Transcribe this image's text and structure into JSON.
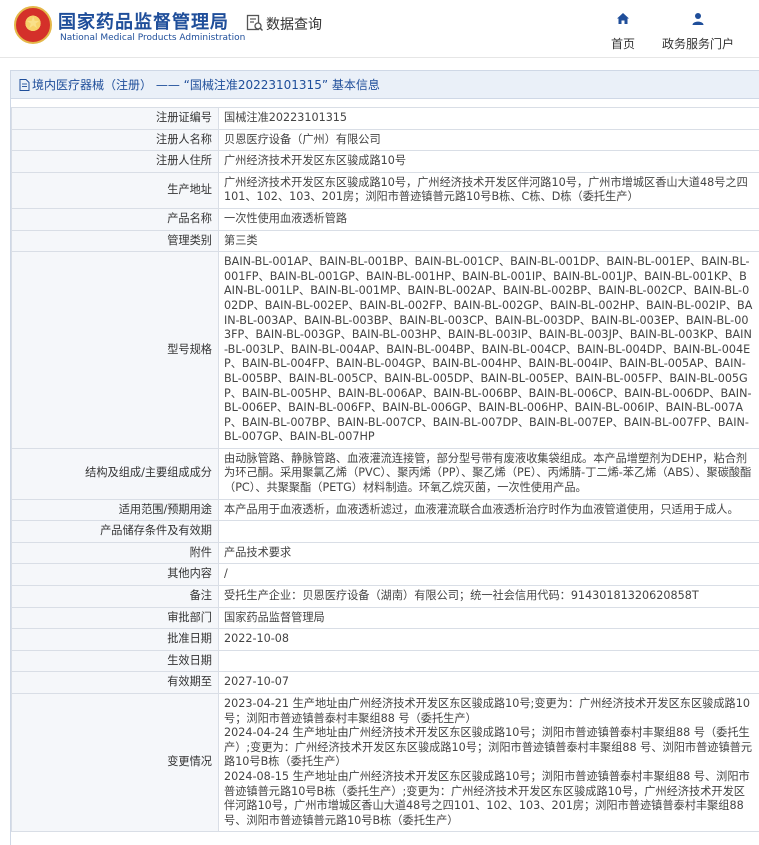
{
  "header": {
    "logo_cn": "国家药品监督管理局",
    "logo_en": "National Medical Products Administration",
    "search_title": "数据查询",
    "nav": [
      {
        "label": "首页",
        "icon": "home-icon"
      },
      {
        "label": "政务服务门户",
        "icon": "user-icon"
      }
    ]
  },
  "panel": {
    "breadcrumb": "境内医疗器械（注册） —— “国械注准20223101315” 基本信息"
  },
  "rows": [
    {
      "label": "注册证编号",
      "value": "国械注准20223101315"
    },
    {
      "label": "注册人名称",
      "value": "贝恩医疗设备（广州）有限公司"
    },
    {
      "label": "注册人住所",
      "value": "广州经济技术开发区东区骏成路10号"
    },
    {
      "label": "生产地址",
      "value": "广州经济技术开发区东区骏成路10号，广州经济技术开发区伴河路10号，广州市增城区香山大道48号之四101、102、103、201房；浏阳市普迹镇普元路10号B栋、C栋、D栋（委托生产）"
    },
    {
      "label": "产品名称",
      "value": "一次性使用血液透析管路"
    },
    {
      "label": "管理类别",
      "value": "第三类"
    },
    {
      "label": "型号规格",
      "value": "BAIN-BL-001AP、BAIN-BL-001BP、BAIN-BL-001CP、BAIN-BL-001DP、BAIN-BL-001EP、BAIN-BL-001FP、BAIN-BL-001GP、BAIN-BL-001HP、BAIN-BL-001IP、BAIN-BL-001JP、BAIN-BL-001KP、BAIN-BL-001LP、BAIN-BL-001MP、BAIN-BL-002AP、BAIN-BL-002BP、BAIN-BL-002CP、BAIN-BL-002DP、BAIN-BL-002EP、BAIN-BL-002FP、BAIN-BL-002GP、BAIN-BL-002HP、BAIN-BL-002IP、BAIN-BL-003AP、BAIN-BL-003BP、BAIN-BL-003CP、BAIN-BL-003DP、BAIN-BL-003EP、BAIN-BL-003FP、BAIN-BL-003GP、BAIN-BL-003HP、BAIN-BL-003IP、BAIN-BL-003JP、BAIN-BL-003KP、BAIN-BL-003LP、BAIN-BL-004AP、BAIN-BL-004BP、BAIN-BL-004CP、BAIN-BL-004DP、BAIN-BL-004EP、BAIN-BL-004FP、BAIN-BL-004GP、BAIN-BL-004HP、BAIN-BL-004IP、BAIN-BL-005AP、BAIN-BL-005BP、BAIN-BL-005CP、BAIN-BL-005DP、BAIN-BL-005EP、BAIN-BL-005FP、BAIN-BL-005GP、BAIN-BL-005HP、BAIN-BL-006AP、BAIN-BL-006BP、BAIN-BL-006CP、BAIN-BL-006DP、BAIN-BL-006EP、BAIN-BL-006FP、BAIN-BL-006GP、BAIN-BL-006HP、BAIN-BL-006IP、BAIN-BL-007AP、BAIN-BL-007BP、BAIN-BL-007CP、BAIN-BL-007DP、BAIN-BL-007EP、BAIN-BL-007FP、BAIN-BL-007GP、BAIN-BL-007HP"
    },
    {
      "label": "结构及组成/主要组成成分",
      "value": "由动脉管路、静脉管路、血液灌流连接管，部分型号带有废液收集袋组成。本产品增塑剂为DEHP，粘合剂为环己酮。采用聚氯乙烯（PVC）、聚丙烯（PP）、聚乙烯（PE）、丙烯腈-丁二烯-苯乙烯（ABS）、聚碳酸酯（PC）、共聚聚酯（PETG）材料制造。环氧乙烷灭菌，一次性使用产品。"
    },
    {
      "label": "适用范围/预期用途",
      "value": "本产品用于血液透析，血液透析滤过，血液灌流联合血液透析治疗时作为血液管道使用，只适用于成人。"
    },
    {
      "label": "产品储存条件及有效期",
      "value": ""
    },
    {
      "label": "附件",
      "value": "产品技术要求"
    },
    {
      "label": "其他内容",
      "value": "/"
    },
    {
      "label": "备注",
      "value": "受托生产企业：贝恩医疗设备（湖南）有限公司；统一社会信用代码：91430181320620858T"
    },
    {
      "label": "审批部门",
      "value": "国家药品监督管理局"
    },
    {
      "label": "批准日期",
      "value": "2022-10-08"
    },
    {
      "label": "生效日期",
      "value": ""
    },
    {
      "label": "有效期至",
      "value": "2027-10-07"
    }
  ],
  "changes": {
    "label": "变更情况",
    "entries": [
      "2023-04-21 生产地址由广州经济技术开发区东区骏成路10号;变更为：广州经济技术开发区东区骏成路10号；浏阳市普迹镇普泰村丰聚组88 号（委托生产）",
      "2024-04-24 生产地址由广州经济技术开发区东区骏成路10号；浏阳市普迹镇普泰村丰聚组88 号（委托生产）;变更为：广州经济技术开发区东区骏成路10号；浏阳市普迹镇普泰村丰聚组88 号、浏阳市普迹镇普元路10号B栋（委托生产）",
      "2024-08-15 生产地址由广州经济技术开发区东区骏成路10号；浏阳市普迹镇普泰村丰聚组88 号、浏阳市普迹镇普元路10号B栋（委托生产）;变更为：广州经济技术开发区东区骏成路10号，广州经济技术开发区伴河路10号，广州市增城区香山大道48号之四101、102、103、201房；浏阳市普迹镇普泰村丰聚组88号、浏阳市普迹镇普元路10号B栋（委托生产）"
    ]
  },
  "colors": {
    "brand_blue": "#1f4e9a",
    "label_bg": "#f5f7fa",
    "border": "#d9dee6"
  }
}
